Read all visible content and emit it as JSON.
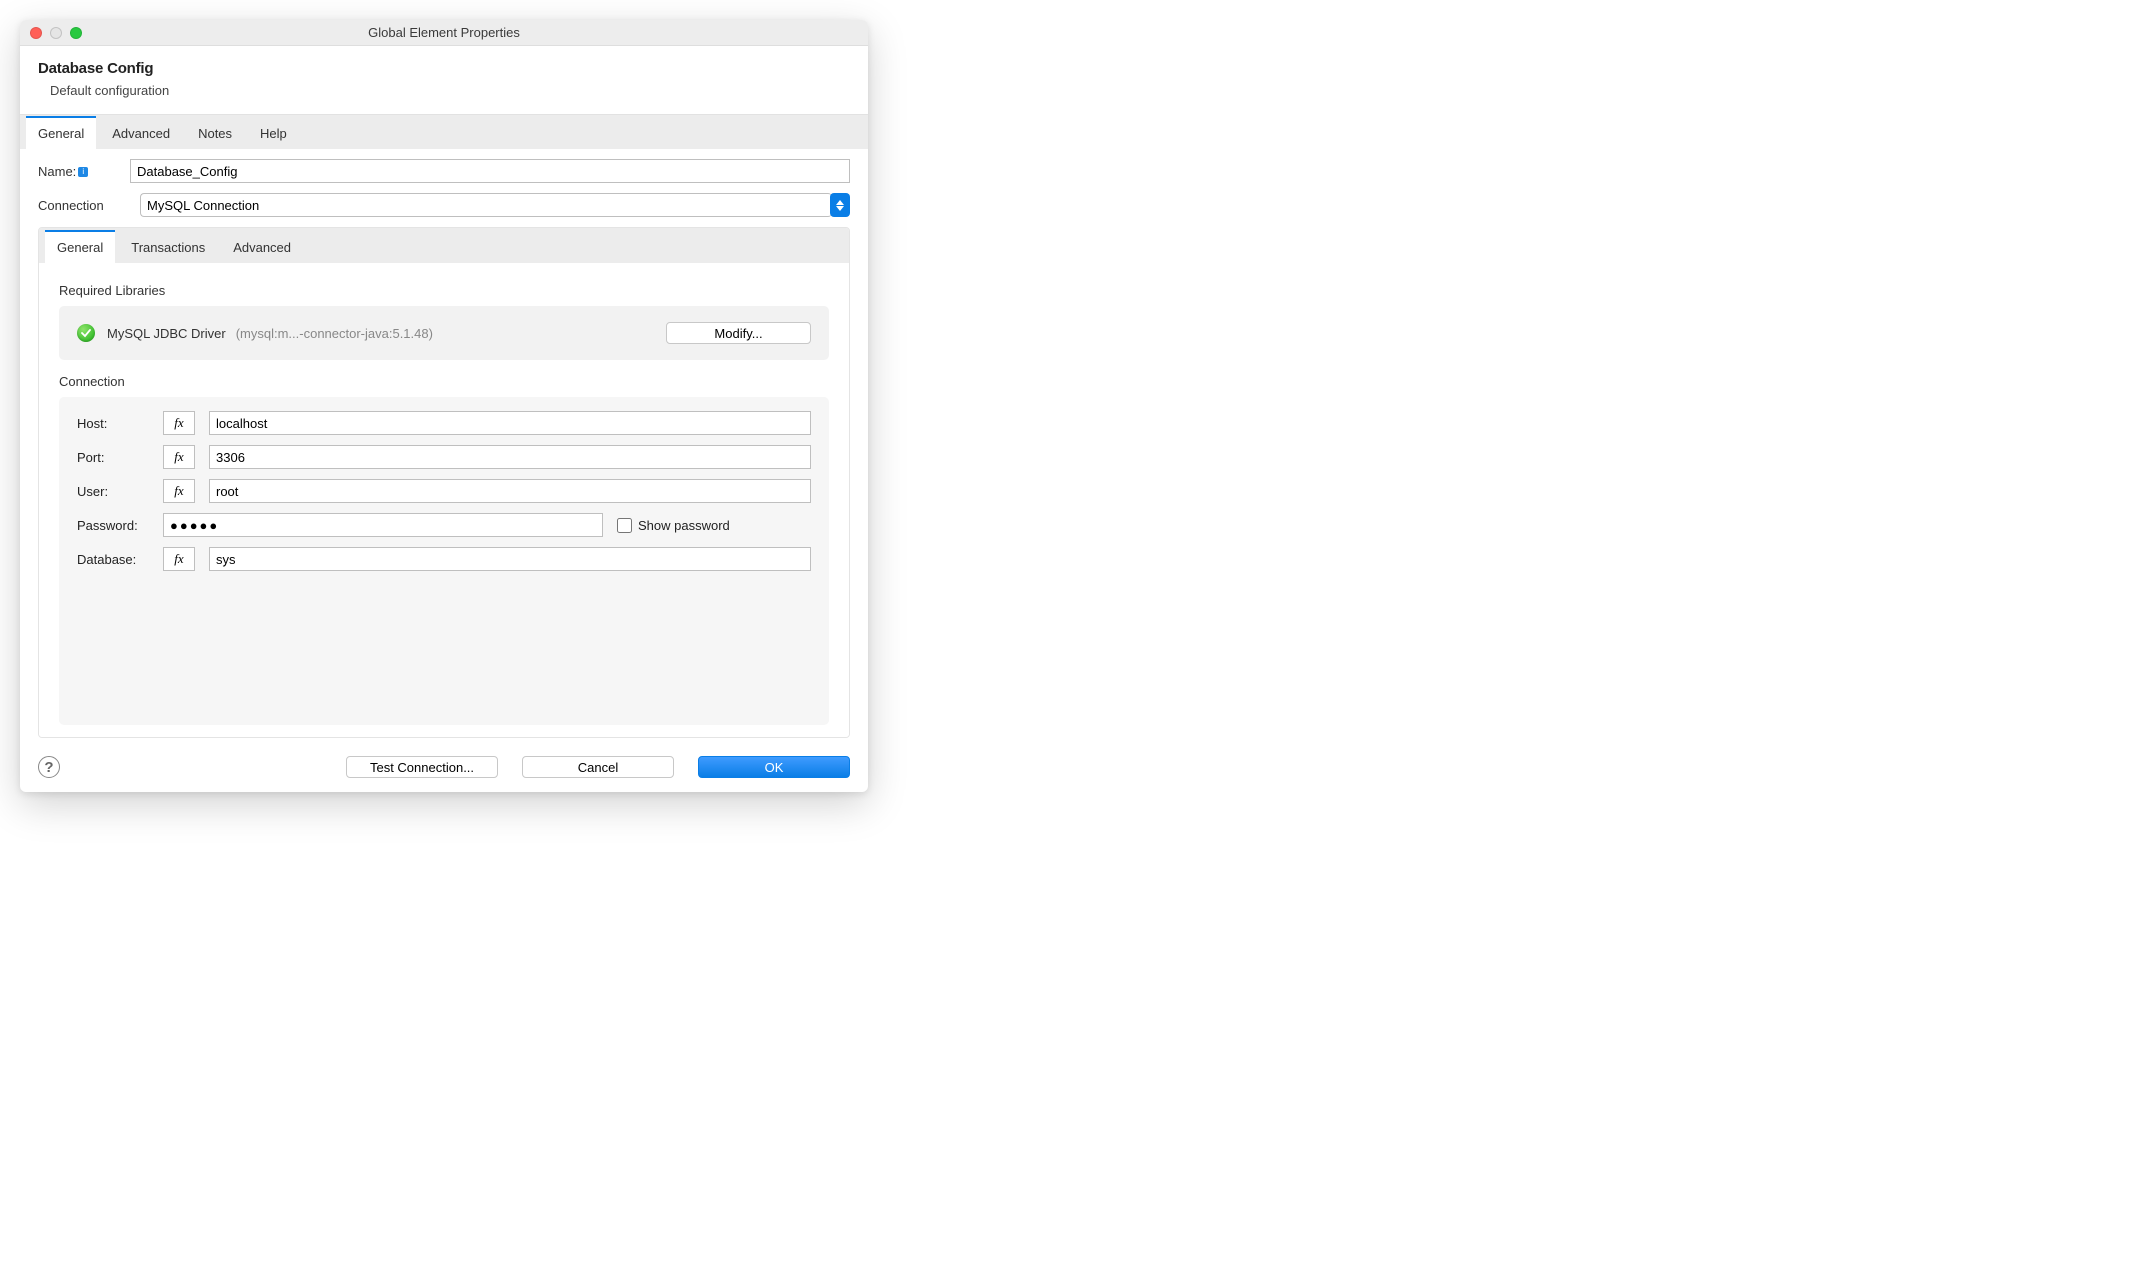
{
  "window": {
    "title": "Global Element Properties"
  },
  "header": {
    "title": "Database Config",
    "subtitle": "Default configuration"
  },
  "tabs": {
    "items": [
      "General",
      "Advanced",
      "Notes",
      "Help"
    ],
    "active": 0
  },
  "form": {
    "nameLabel": "Name:",
    "nameValue": "Database_Config",
    "connLabel": "Connection",
    "connValue": "MySQL Connection"
  },
  "innerTabs": {
    "items": [
      "General",
      "Transactions",
      "Advanced"
    ],
    "active": 0
  },
  "libs": {
    "section": "Required Libraries",
    "name": "MySQL JDBC Driver",
    "detail": "(mysql:m...-connector-java:5.1.48)",
    "modify": "Modify..."
  },
  "conn": {
    "section": "Connection",
    "hostLabel": "Host:",
    "hostValue": "localhost",
    "portLabel": "Port:",
    "portValue": "3306",
    "userLabel": "User:",
    "userValue": "root",
    "pwLabel": "Password:",
    "pwValue": "●●●●●",
    "showPw": "Show password",
    "dbLabel": "Database:",
    "dbValue": "sys",
    "fx": "fx"
  },
  "footer": {
    "test": "Test Connection...",
    "cancel": "Cancel",
    "ok": "OK"
  }
}
